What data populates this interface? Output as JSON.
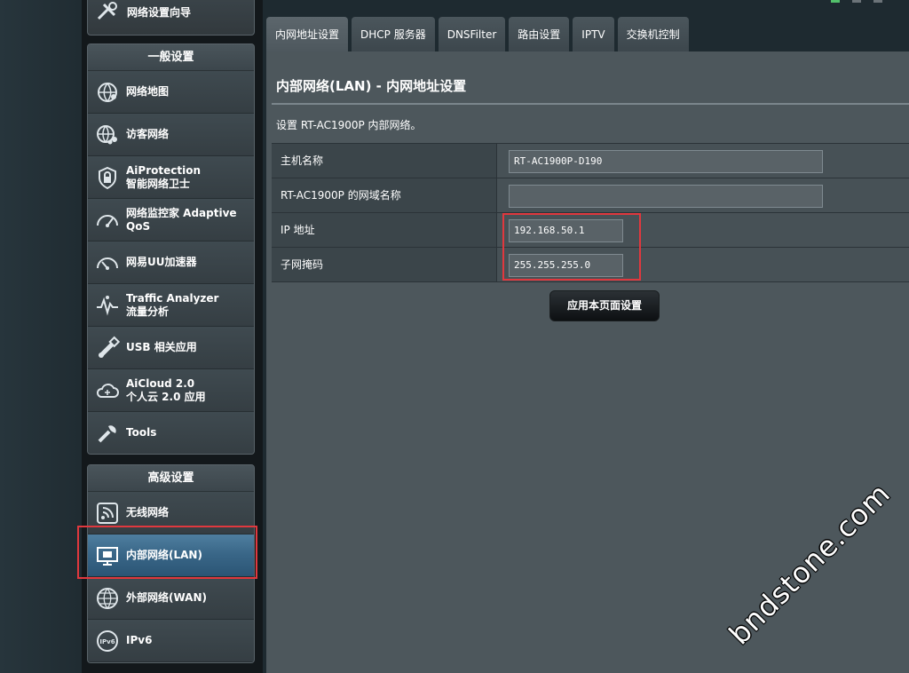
{
  "sidebar": {
    "wizard_label": "网络设置向导",
    "general_title": "一般设置",
    "general_items": [
      {
        "label": "网络地图",
        "icon": "network-map-icon"
      },
      {
        "label": "访客网络",
        "icon": "guest-network-icon"
      },
      {
        "label": "AiProtection\n智能网络卫士",
        "icon": "aiprotection-icon"
      },
      {
        "label": "网络监控家 Adaptive\nQoS",
        "icon": "qos-gauge-icon"
      },
      {
        "label": "网易UU加速器",
        "icon": "uu-accelerator-icon"
      },
      {
        "label": "Traffic Analyzer\n流量分析",
        "icon": "traffic-analyzer-icon"
      },
      {
        "label": "USB 相关应用",
        "icon": "usb-icon"
      },
      {
        "label": "AiCloud 2.0\n个人云 2.0 应用",
        "icon": "aicloud-icon"
      },
      {
        "label": "Tools",
        "icon": "tools-icon"
      }
    ],
    "advanced_title": "高级设置",
    "advanced_items": [
      {
        "label": "无线网络",
        "icon": "wireless-icon"
      },
      {
        "label": "内部网络(LAN)",
        "icon": "lan-icon"
      },
      {
        "label": "外部网络(WAN)",
        "icon": "wan-globe-icon"
      },
      {
        "label": "IPv6",
        "icon": "ipv6-icon"
      }
    ]
  },
  "tabs": [
    "内网地址设置",
    "DHCP 服务器",
    "DNSFilter",
    "路由设置",
    "IPTV",
    "交换机控制"
  ],
  "active_tab": 0,
  "main": {
    "title": "内部网络(LAN) - 内网地址设置",
    "description": "设置 RT-AC1900P 内部网络。",
    "fields": [
      {
        "label": "主机名称",
        "value": ""
      },
      {
        "label": "RT-AC1900P 的网域名称",
        "value": ""
      },
      {
        "label": "IP 地址",
        "value": "192.168.50.1"
      },
      {
        "label": "子网掩码",
        "value": "255.255.255.0"
      }
    ],
    "hostname_value": "RT-AC1900P-D190",
    "apply_button": "应用本页面设置"
  },
  "watermark": "bndstone.com",
  "colors": {
    "highlight": "#e0383e",
    "active_item": "#3a6788",
    "panel": "#4d575c"
  }
}
